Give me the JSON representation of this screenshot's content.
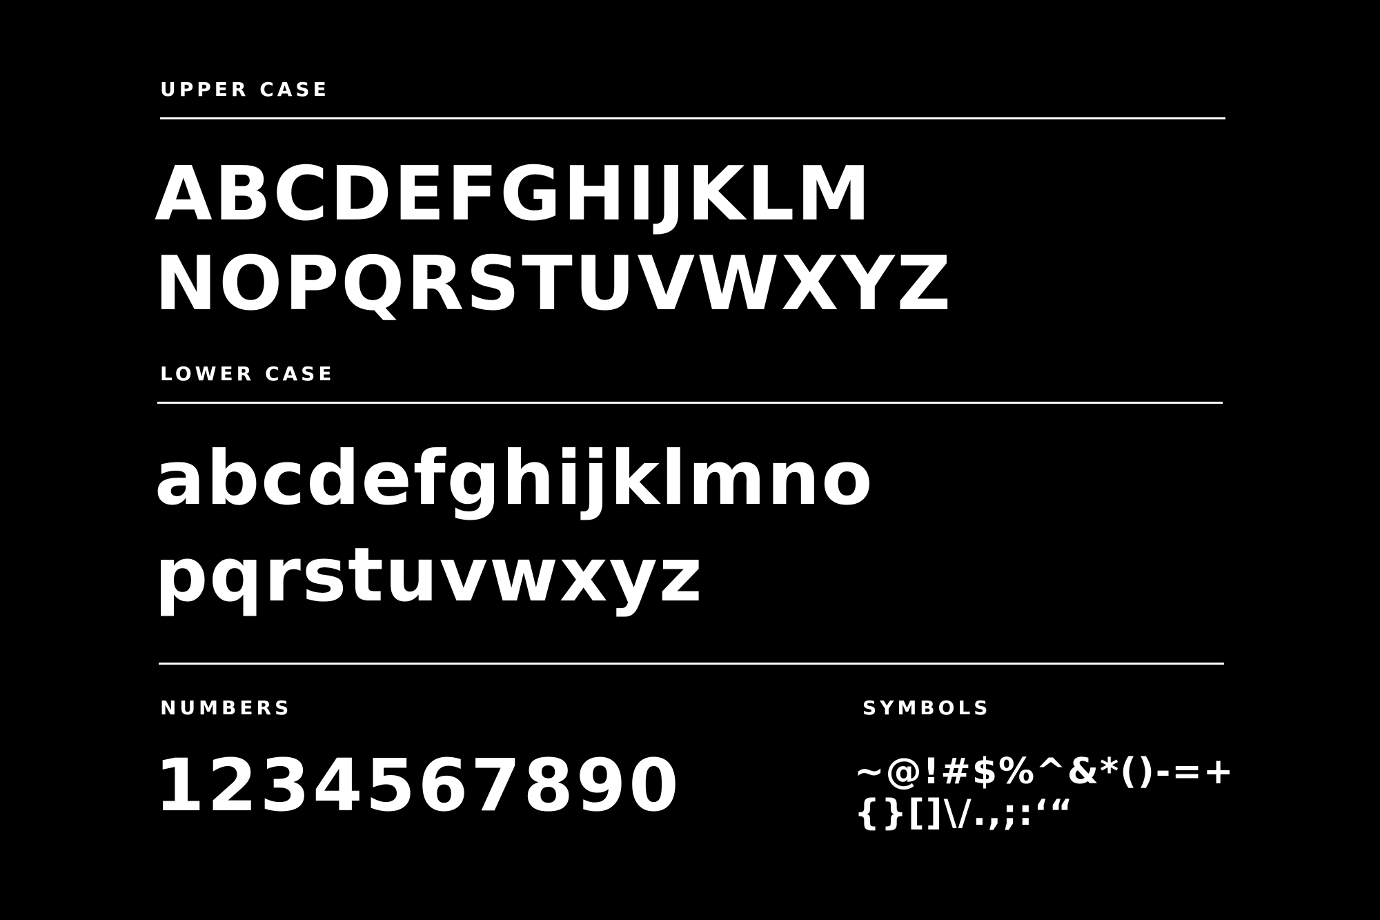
{
  "sections": {
    "upper_case": {
      "label": "UPPER CASE",
      "lines": [
        "ABCDEFGHIJKLM",
        "NOPQRSTUVWXYZ"
      ]
    },
    "lower_case": {
      "label": "LOWER CASE",
      "lines": [
        "abcdefghijklmno",
        "pqrstuvwxyz"
      ]
    },
    "numbers": {
      "label": "NUMBERS",
      "line": "1234567890"
    },
    "symbols": {
      "label": "SYMBOLS",
      "lines": [
        "~@!#$%^&*()-=+",
        "{}[]\\/.,;:‘“"
      ]
    }
  },
  "colors": {
    "background": "#000000",
    "foreground": "#ffffff"
  }
}
